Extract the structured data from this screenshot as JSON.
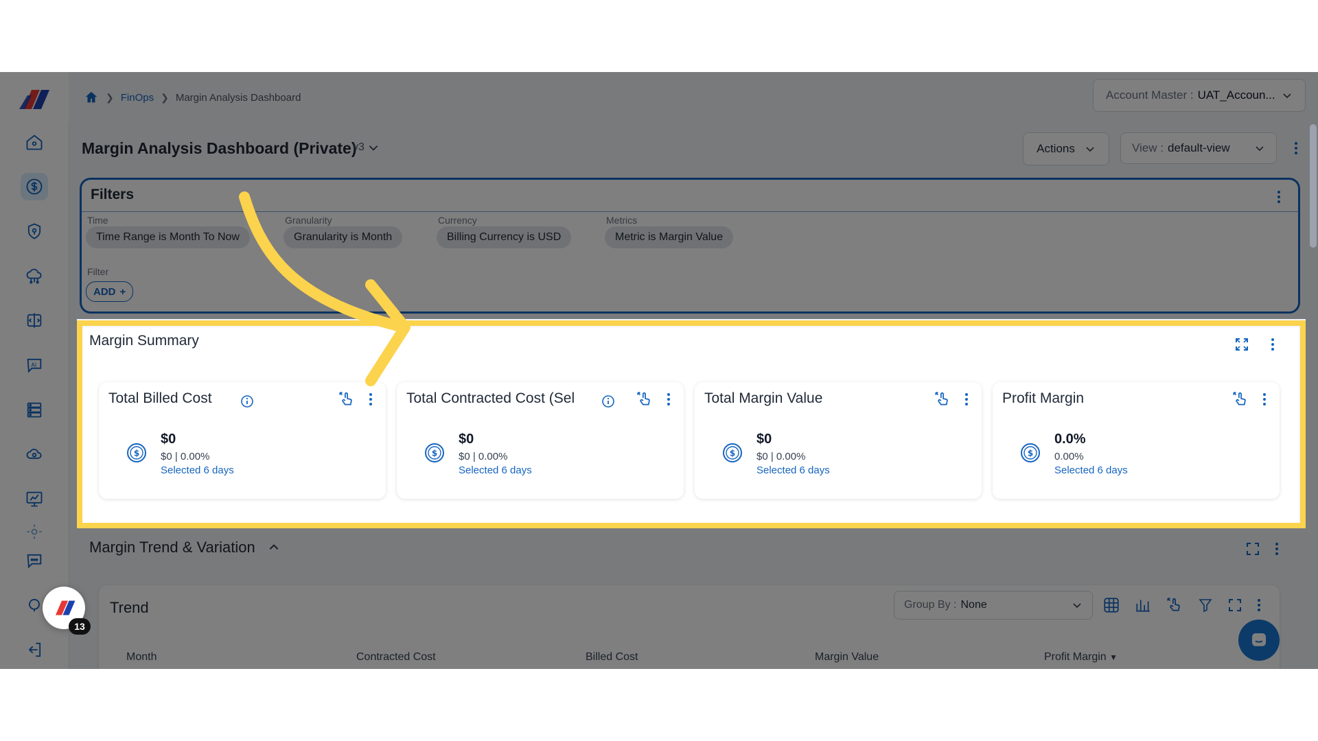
{
  "breadcrumb": {
    "home_icon": "home-icon",
    "items": [
      "FinOps",
      "Margin Analysis Dashboard"
    ]
  },
  "account": {
    "label": "Account Master :",
    "value": "UAT_Accoun..."
  },
  "dashboard": {
    "title": "Margin Analysis Dashboard (Private)",
    "version": "v3",
    "actions_label": "Actions",
    "view_label": "View :",
    "view_value": "default-view"
  },
  "filters": {
    "title": "Filters",
    "groups": [
      {
        "label": "Time",
        "chip": "Time Range is Month To Now"
      },
      {
        "label": "Granularity",
        "chip": "Granularity is Month"
      },
      {
        "label": "Currency",
        "chip": "Billing Currency is USD"
      },
      {
        "label": "Metrics",
        "chip": "Metric is Margin Value"
      }
    ],
    "filter_label": "Filter",
    "add_label": "ADD"
  },
  "summary": {
    "title": "Margin Summary",
    "cards": [
      {
        "title": "Total Billed Cost",
        "has_info": true,
        "value": "$0",
        "sub": "$0 | 0.00%",
        "selected": "Selected 6 days"
      },
      {
        "title": "Total Contracted Cost (Sel",
        "has_info": true,
        "value": "$0",
        "sub": "$0 | 0.00%",
        "selected": "Selected 6 days"
      },
      {
        "title": "Total Margin Value",
        "has_info": false,
        "value": "$0",
        "sub": "$0 | 0.00%",
        "selected": "Selected 6 days"
      },
      {
        "title": "Profit Margin",
        "has_info": false,
        "value": "0.0%",
        "sub": "0.00%",
        "selected": "Selected 6 days"
      }
    ]
  },
  "trend": {
    "section_title": "Margin Trend & Variation",
    "card_title": "Trend",
    "group_by_label": "Group By :",
    "group_by_value": "None",
    "columns": [
      "Month",
      "Contracted Cost",
      "Billed Cost",
      "Margin Value",
      "Profit Margin"
    ]
  },
  "notifications": {
    "count": "13"
  },
  "colors": {
    "accent": "#1565c0",
    "highlight": "#fcd34d",
    "arrow": "#fcd34d",
    "active_nav_bg": "#d9ecff"
  }
}
